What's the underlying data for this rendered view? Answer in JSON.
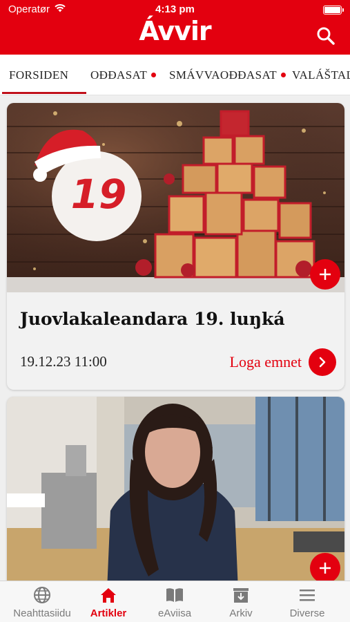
{
  "status_bar": {
    "carrier": "Operatør",
    "time": "4:13 pm"
  },
  "header": {
    "logo": "Ávvir"
  },
  "tabs": [
    {
      "label": "FORSIDEN",
      "active": true,
      "dot": false
    },
    {
      "label": "OĐĐASAT",
      "active": false,
      "dot": true
    },
    {
      "label": "SMÁVVAOĐĐASAT",
      "active": false,
      "dot": true
    },
    {
      "label": "VALÁŠTALI",
      "active": false,
      "dot": false
    }
  ],
  "articles": [
    {
      "calendar_day": "19",
      "title": "Juovlakaleandara 19. luŋká",
      "date": "19.12.23 11:00",
      "read_more": "Loga emnet"
    },
    {}
  ],
  "bottom_nav": [
    {
      "label": "Neahttasiidu",
      "icon": "globe-icon",
      "active": false
    },
    {
      "label": "Artikler",
      "icon": "home-icon",
      "active": true
    },
    {
      "label": "eAviisa",
      "icon": "book-icon",
      "active": false
    },
    {
      "label": "Arkiv",
      "icon": "archive-icon",
      "active": false
    },
    {
      "label": "Diverse",
      "icon": "menu-icon",
      "active": false
    }
  ],
  "colors": {
    "accent": "#e3000f",
    "nav_inactive": "#7a7a7a",
    "background": "#efefef"
  }
}
